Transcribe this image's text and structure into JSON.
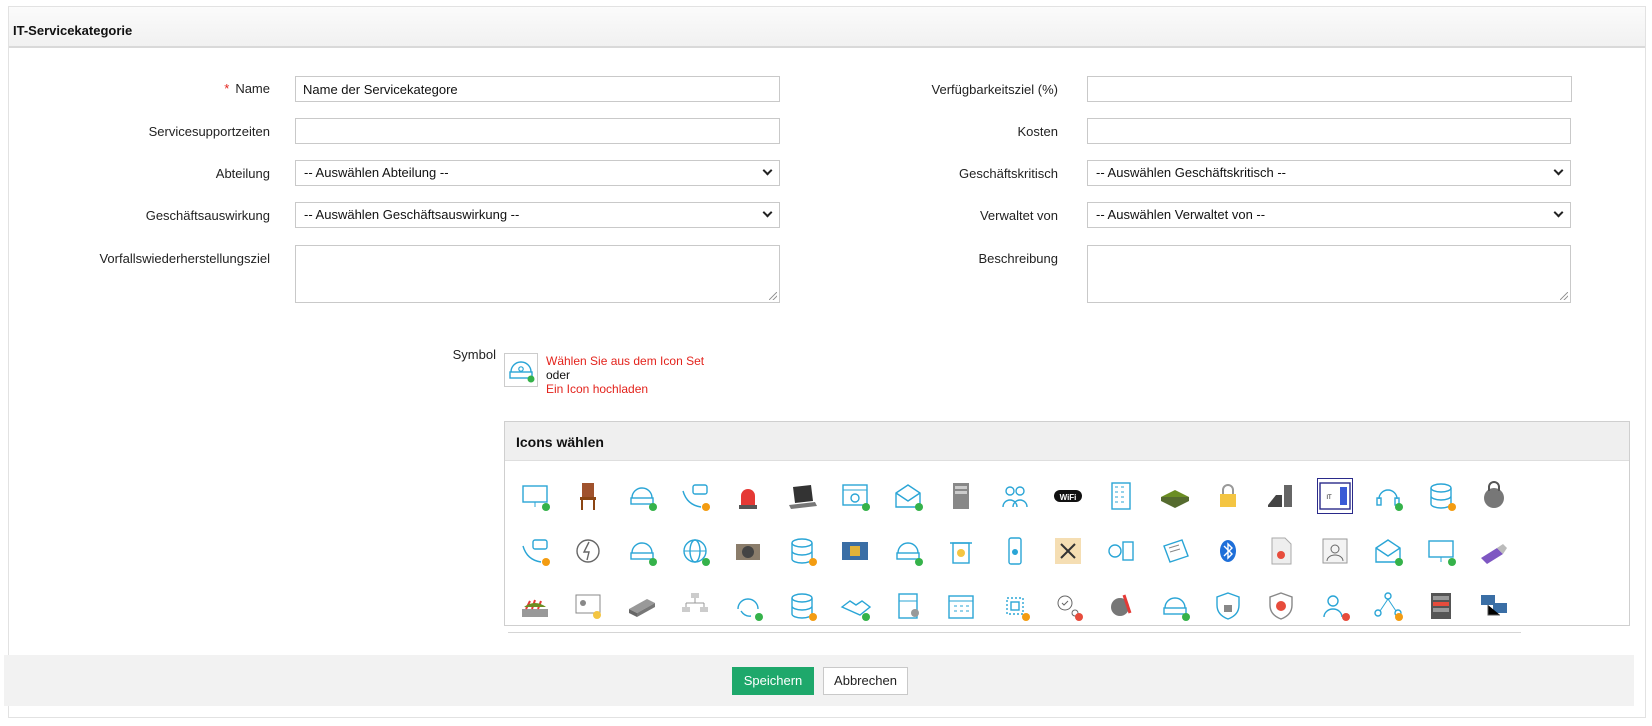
{
  "panel": {
    "title": "IT-Servicekategorie"
  },
  "form": {
    "name_label": "Name",
    "name_value": "Name der Servicekategore",
    "support_label": "Servicesupportzeiten",
    "support_value": "",
    "department_label": "Abteilung",
    "department_value": "-- Auswählen Abteilung --",
    "impact_label": "Geschäftsauswirkung",
    "impact_value": "-- Auswählen Geschäftsauswirkung --",
    "recovery_label": "Vorfallswiederherstellungsziel",
    "availability_label": "Verfügbarkeitsziel (%)",
    "availability_value": "",
    "cost_label": "Kosten",
    "cost_value": "",
    "critical_label": "Geschäftskritisch",
    "critical_value": "-- Auswählen Geschäftskritisch --",
    "managed_label": "Verwaltet von",
    "managed_value": "-- Auswählen Verwaltet von --",
    "description_label": "Beschreibung"
  },
  "symbol": {
    "label": "Symbol",
    "choose_link": "Wählen Sie aus dem Icon Set",
    "or_text": "oder",
    "upload_link": "Ein Icon hochladen"
  },
  "icon_picker": {
    "title": "Icons wählen",
    "rows": [
      [
        "monitor-icon",
        "chair-icon",
        "helpdesk-icon",
        "voicemail-icon",
        "siren-icon",
        "laptop-icon",
        "web-page-icon",
        "mail-network-icon",
        "server-tower-icon",
        "users-group-icon",
        "wifi-icon",
        "building-icon",
        "network-switch-icon",
        "lock-icon",
        "desk-phone-icon",
        "it-workplace-icon",
        "headset-icon",
        "database-icon",
        "padlock-icon"
      ],
      [
        "voicemail-icon",
        "power-icon",
        "helpdesk-icon",
        "globe-icon",
        "camera-icon",
        "database-icon",
        "sim-card-icon",
        "helpdesk-icon",
        "trash-bin-icon",
        "mobile-phone-icon",
        "tools-icon",
        "fan-server-icon",
        "certificate-icon",
        "bluetooth-icon",
        "document-icon",
        "sparkle-user-icon",
        "mail-network-icon",
        "monitor-icon",
        "usb-drive-icon"
      ],
      [
        "router-icon",
        "badge-icon",
        "hard-drive-icon",
        "organization-chart-icon",
        "support-call-icon",
        "database-icon",
        "handshake-icon",
        "storage-icon",
        "calendar-icon",
        "chip-icon",
        "user-check-icon",
        "settings-wrench-icon",
        "helpdesk-icon",
        "shield-lock-icon",
        "shield-icon",
        "user-remove-icon",
        "network-node-icon",
        "rack-server-icon",
        "computers-network-icon"
      ]
    ]
  },
  "colors": {
    "primary": "#1ea86b",
    "link": "#e3231c",
    "icon_blue": "#2aa5d6",
    "badge_green": "#35b24a",
    "badge_orange": "#f39c12",
    "badge_red": "#e74c3c"
  },
  "buttons": {
    "save": "Speichern",
    "cancel": "Abbrechen"
  }
}
